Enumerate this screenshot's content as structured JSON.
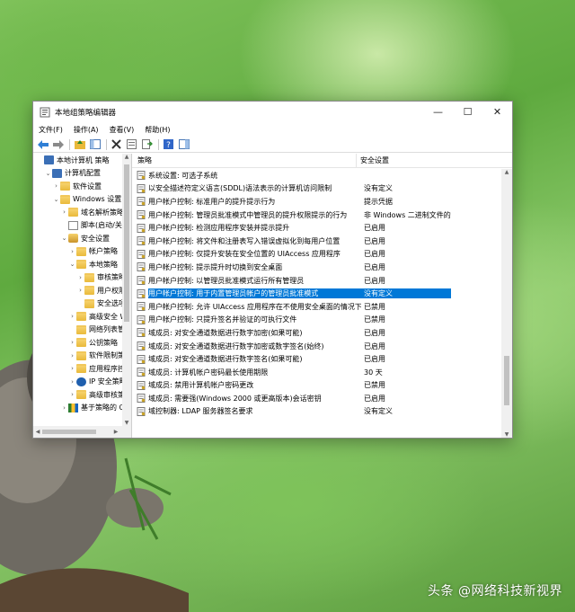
{
  "window": {
    "title": "本地组策略编辑器",
    "controls": {
      "minimize": "—",
      "maximize": "☐",
      "close": "✕"
    }
  },
  "menu": [
    "文件(F)",
    "操作(A)",
    "查看(V)",
    "帮助(H)"
  ],
  "toolbar_icons": [
    "back-icon",
    "forward-icon",
    "up-folder-icon",
    "show-hide-tree-icon",
    "delete-icon",
    "properties-icon",
    "export-list-icon",
    "help-icon",
    "show-pane-icon"
  ],
  "tree": [
    {
      "label": "本地计算机 策略",
      "indent": 0,
      "twisty": "",
      "icon": "computer-policy-icon"
    },
    {
      "label": "计算机配置",
      "indent": 1,
      "twisty": "⌄",
      "icon": "computer-icon"
    },
    {
      "label": "软件设置",
      "indent": 2,
      "twisty": "›",
      "icon": "folder-icon"
    },
    {
      "label": "Windows 设置",
      "indent": 2,
      "twisty": "⌄",
      "icon": "folder-icon"
    },
    {
      "label": "域名解析策略",
      "indent": 3,
      "twisty": "›",
      "icon": "folder-icon"
    },
    {
      "label": "脚本(启动/关机)",
      "indent": 3,
      "twisty": "",
      "icon": "script-icon"
    },
    {
      "label": "安全设置",
      "indent": 3,
      "twisty": "⌄",
      "icon": "security-icon"
    },
    {
      "label": "帐户策略",
      "indent": 4,
      "twisty": "›",
      "icon": "folder-icon"
    },
    {
      "label": "本地策略",
      "indent": 4,
      "twisty": "⌄",
      "icon": "folder-icon"
    },
    {
      "label": "审核策略",
      "indent": 5,
      "twisty": "›",
      "icon": "folder-icon"
    },
    {
      "label": "用户权限分配",
      "indent": 5,
      "twisty": "›",
      "icon": "folder-icon"
    },
    {
      "label": "安全选项",
      "indent": 5,
      "twisty": "",
      "icon": "folder-open-icon"
    },
    {
      "label": "高级安全 Windows Defender 防火墙",
      "indent": 4,
      "twisty": "›",
      "icon": "folder-icon"
    },
    {
      "label": "网络列表管理器策略",
      "indent": 4,
      "twisty": "",
      "icon": "folder-icon"
    },
    {
      "label": "公钥策略",
      "indent": 4,
      "twisty": "›",
      "icon": "folder-icon"
    },
    {
      "label": "软件限制策略",
      "indent": 4,
      "twisty": "›",
      "icon": "folder-icon"
    },
    {
      "label": "应用程序控制策略",
      "indent": 4,
      "twisty": "›",
      "icon": "folder-icon"
    },
    {
      "label": "IP 安全策略，在 本地计算机",
      "indent": 4,
      "twisty": "›",
      "icon": "ip-security-icon"
    },
    {
      "label": "高级审核策略配置",
      "indent": 4,
      "twisty": "›",
      "icon": "folder-icon"
    },
    {
      "label": "基于策略的 QoS",
      "indent": 3,
      "twisty": "›",
      "icon": "qos-chart-icon"
    }
  ],
  "list": {
    "col_policy": "策略",
    "col_setting": "安全设置",
    "rows": [
      {
        "policy": "系统设置: 可选子系统",
        "setting": ""
      },
      {
        "policy": "以安全描述符定义语言(SDDL)语法表示的计算机访问限制",
        "setting": "没有定义"
      },
      {
        "policy": "用户帐户控制: 标准用户的提升提示行为",
        "setting": "提示凭据"
      },
      {
        "policy": "用户帐户控制: 管理员批准模式中管理员的提升权限提示的行为",
        "setting": "非 Windows 二进制文件的同意提示"
      },
      {
        "policy": "用户帐户控制: 检测应用程序安装并提示提升",
        "setting": "已启用"
      },
      {
        "policy": "用户帐户控制: 将文件和注册表写入错误虚拟化到每用户位置",
        "setting": "已启用"
      },
      {
        "policy": "用户帐户控制: 仅提升安装在安全位置的 UIAccess 应用程序",
        "setting": "已启用"
      },
      {
        "policy": "用户帐户控制: 提示提升时切换到安全桌面",
        "setting": "已启用"
      },
      {
        "policy": "用户帐户控制: 以管理员批准模式运行所有管理员",
        "setting": "已启用"
      },
      {
        "policy": "用户帐户控制: 用于内置管理员帐户的管理员批准模式",
        "setting": "没有定义",
        "selected": true
      },
      {
        "policy": "用户帐户控制: 允许 UIAccess 应用程序在不使用安全桌面的情况下提升权限",
        "setting": "已禁用"
      },
      {
        "policy": "用户帐户控制: 只提升签名并验证的可执行文件",
        "setting": "已禁用"
      },
      {
        "policy": "域成员: 对安全通道数据进行数字加密(如果可能)",
        "setting": "已启用"
      },
      {
        "policy": "域成员: 对安全通道数据进行数字加密或数字签名(始终)",
        "setting": "已启用"
      },
      {
        "policy": "域成员: 对安全通道数据进行数字签名(如果可能)",
        "setting": "已启用"
      },
      {
        "policy": "域成员: 计算机帐户密码最长使用期限",
        "setting": "30 天"
      },
      {
        "policy": "域成员: 禁用计算机帐户密码更改",
        "setting": "已禁用"
      },
      {
        "policy": "域成员: 需要强(Windows 2000 或更高版本)会话密钥",
        "setting": "已启用"
      },
      {
        "policy": "域控制器: LDAP 服务器签名要求",
        "setting": "没有定义"
      }
    ]
  },
  "watermark": "头条 @网络科技新视界"
}
